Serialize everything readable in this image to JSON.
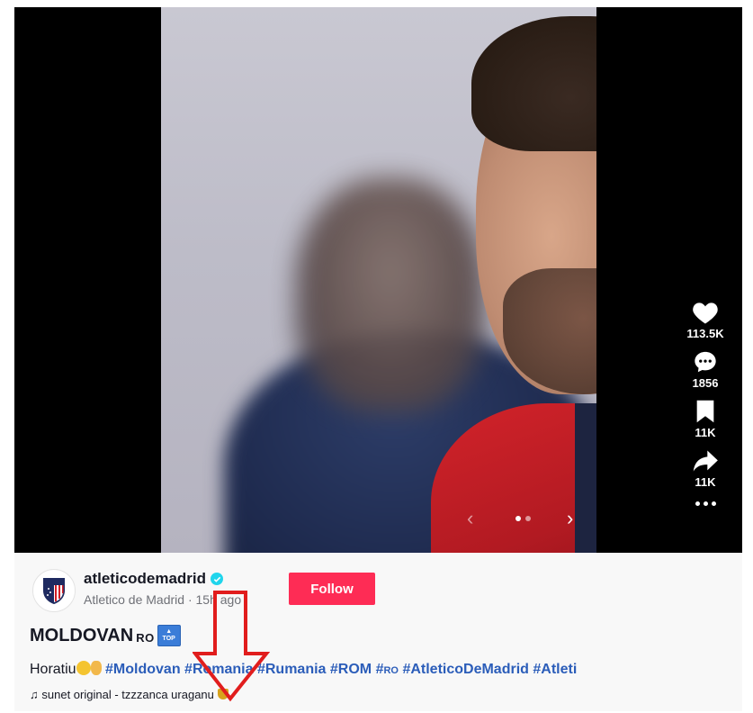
{
  "post": {
    "username": "atleticodemadrid",
    "display_name": "Atletico de Madrid",
    "time_ago": "15h ago",
    "follow_label": "Follow",
    "title": "MOLDOVAN",
    "title_suffix": "RO",
    "badge_text": "TOP",
    "description_prefix": "Horatiu",
    "hashtags": [
      "#Moldovan",
      "#Romania",
      "#Rumania",
      "#ROM",
      "#",
      "#AtleticoDeMadrid",
      "#Atleti"
    ],
    "hashtag_ro_suffix": "RO",
    "music": "sunet original - tzzzanca uraganu"
  },
  "actions": {
    "likes": "113.5K",
    "comments": "1856",
    "saves": "11K",
    "shares": "11K"
  },
  "carousel": {
    "prev_glyph": "‹",
    "next_glyph": "›",
    "total_slides": 2,
    "active_slide": 1
  },
  "icons": {
    "like": "heart-icon",
    "comment": "comment-icon",
    "save": "bookmark-icon",
    "share": "share-icon",
    "more": "more-icon",
    "verified": "verified-icon",
    "music": "music-note-icon"
  },
  "colors": {
    "follow": "#fe2c55",
    "hashtag": "#2b5db9",
    "verified": "#20d5ec",
    "annotation": "#e11d1d"
  }
}
